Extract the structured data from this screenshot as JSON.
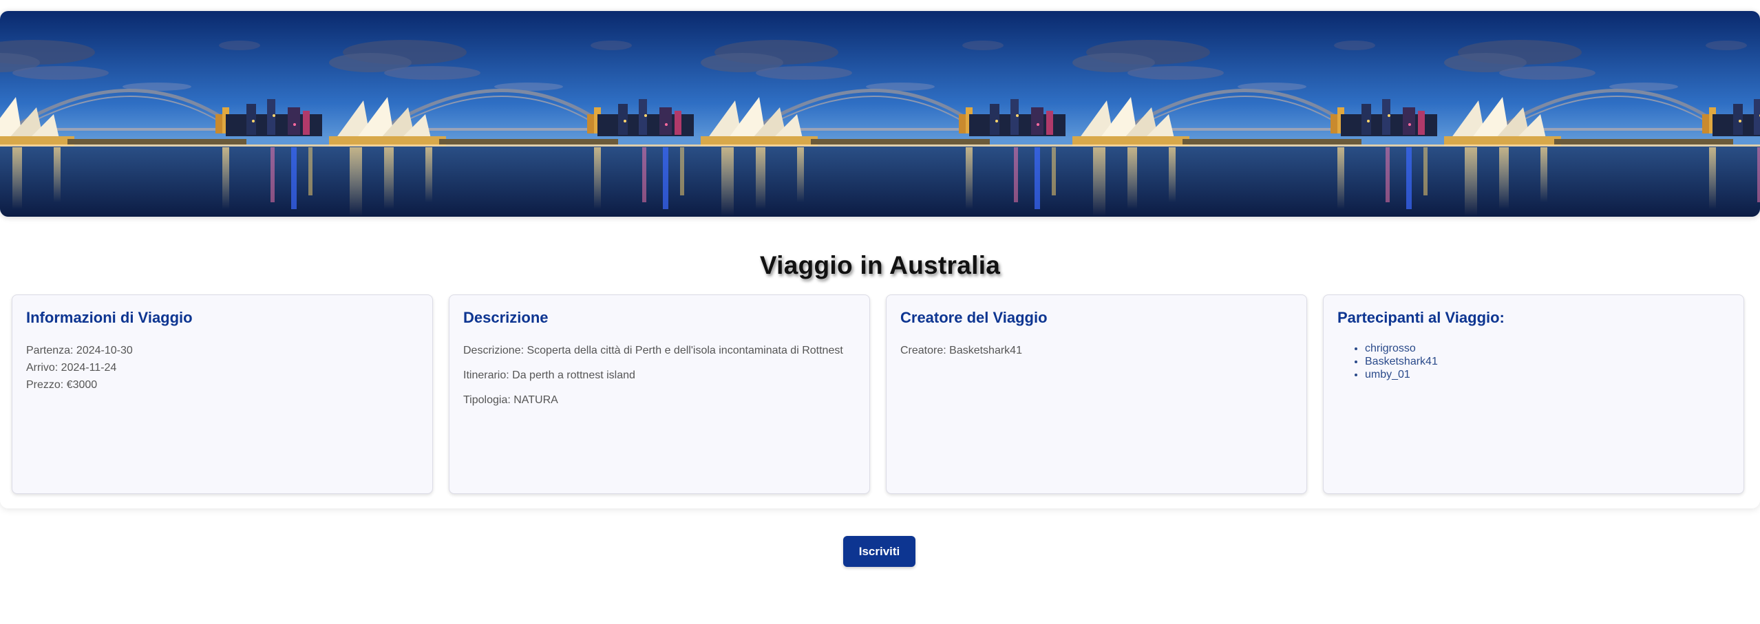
{
  "banner": {
    "image_alt": "Sydney Opera House and Harbour Bridge at dusk",
    "repeat_count": 5
  },
  "page_title": "Viaggio in Australia",
  "cards": {
    "info": {
      "title": "Informazioni di Viaggio",
      "partenza": "Partenza: 2024-10-30",
      "arrivo": "Arrivo: 2024-11-24",
      "prezzo": "Prezzo: €3000"
    },
    "descrizione": {
      "title": "Descrizione",
      "descrizione": "Descrizione: Scoperta della città di Perth e dell'isola incontaminata di Rottnest",
      "itinerario": "Itinerario: Da perth a rottnest island",
      "tipologia": "Tipologia: NATURA"
    },
    "creatore": {
      "title": "Creatore del Viaggio",
      "creatore": "Creatore: Basketshark41"
    },
    "partecipanti": {
      "title": "Partecipanti al Viaggio:",
      "items": [
        "chrigrosso",
        "Basketshark41",
        "umby_01"
      ]
    }
  },
  "actions": {
    "subscribe_label": "Iscriviti"
  },
  "colors": {
    "accent": "#0d3591",
    "card_bg": "#f8f8fd",
    "title_text": "#111111"
  }
}
